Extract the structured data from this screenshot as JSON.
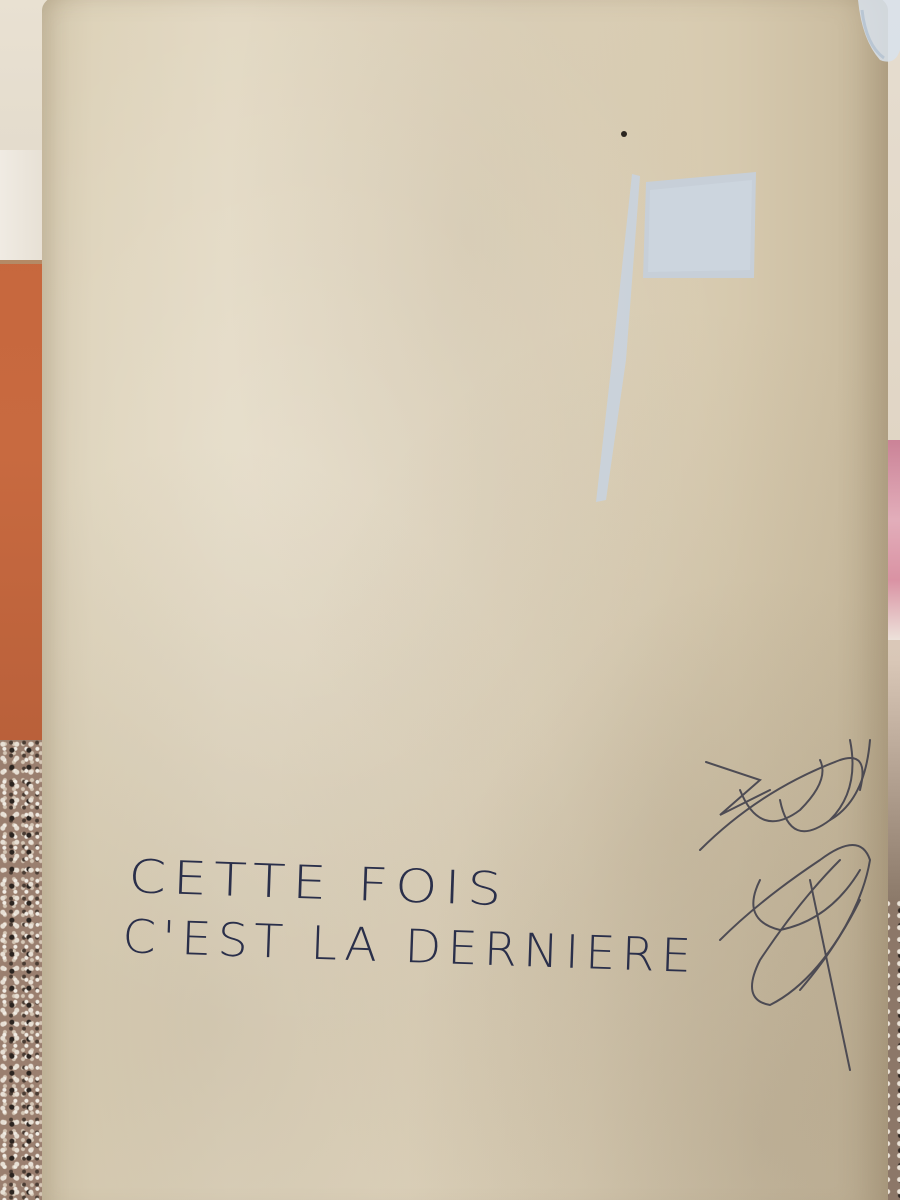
{
  "scene": {
    "description_label": "",
    "graffiti": {
      "line1": "CETTE FOIS",
      "line2": "C'EST LA DERNIERE",
      "ink_color": "#2a2f4a"
    },
    "colors": {
      "column": "#ddd2b9",
      "wall": "#c86a40",
      "flag_paint": "#c9d2dc"
    }
  }
}
